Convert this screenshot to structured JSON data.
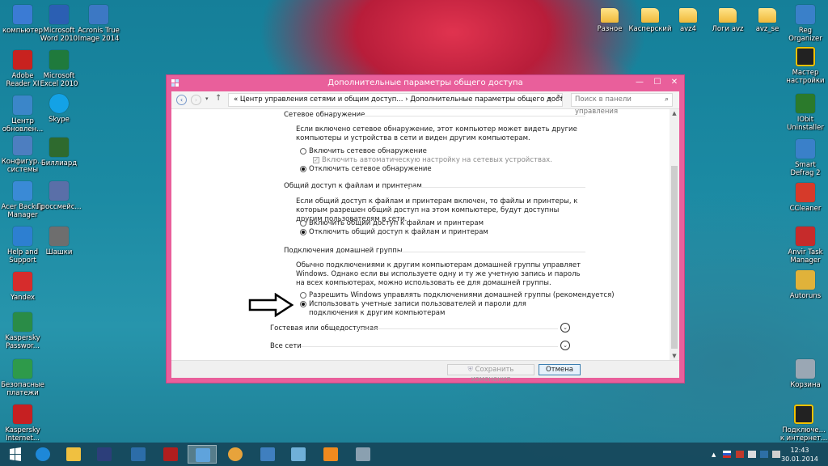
{
  "desktop": {
    "left_icons": [
      {
        "label": "компьютер",
        "color": "#3b7bd4"
      },
      {
        "label": "Adobe Reader XI",
        "color": "#c8221f"
      },
      {
        "label": "Центр обновлен...",
        "color": "#3b86c9"
      },
      {
        "label": "Конфигур... системы",
        "color": "#4d7ec0"
      },
      {
        "label": "Acer Backup Manager",
        "color": "#3a8ad6"
      },
      {
        "label": "Help and Support",
        "color": "#2d7fd1"
      },
      {
        "label": "Yandex",
        "color": "#d62c2c"
      },
      {
        "label": "Kaspersky Passwor...",
        "color": "#2a8c47"
      },
      {
        "label": "Безопасные платежи",
        "color": "#2e9a4a"
      },
      {
        "label": "Kaspersky Internet...",
        "color": "#c62022"
      }
    ],
    "col2_icons": [
      {
        "label": "Microsoft Word 2010",
        "color": "#2b5fb3"
      },
      {
        "label": "Microsoft Excel 2010",
        "color": "#1f7a3c"
      },
      {
        "label": "Skype",
        "color": "#13a2e6"
      },
      {
        "label": "Биллиард",
        "color": "#2e6a2e"
      },
      {
        "label": "Гроссмейс...",
        "color": "#5a6fa8"
      },
      {
        "label": "Шашки",
        "color": "#6e6e6e"
      }
    ],
    "col3_icons": [
      {
        "label": "Acronis True Image 2014",
        "color": "#3c78c4"
      }
    ],
    "top_folders": [
      "Разное",
      "Касперский",
      "avz4",
      "Логи avz",
      "avz_se"
    ],
    "right_icons": [
      {
        "label": "Reg Organizer",
        "color": "#3a80c9"
      },
      {
        "label": "Мастер настройки",
        "color": "#222222"
      },
      {
        "label": "IObit Uninstaller",
        "color": "#2b7a2b"
      },
      {
        "label": "Smart Defrag 2",
        "color": "#3a80c9"
      },
      {
        "label": "CCleaner",
        "color": "#d63a2a"
      },
      {
        "label": "Anvir Task Manager",
        "color": "#c62b2b"
      },
      {
        "label": "Autoruns",
        "color": "#e0b23a"
      },
      {
        "label": "Корзина",
        "color": "#9aa7b4"
      },
      {
        "label": "Подключе... к интернет...",
        "color": "#222222"
      }
    ]
  },
  "window": {
    "title": "Дополнительные параметры общего доступа",
    "min": "—",
    "max": "☐",
    "close": "✕",
    "address": "« Центр управления сетями и общим доступ... › Дополнительные параметры общего доступа",
    "search_placeholder": "Поиск в панели управления",
    "sections": {
      "discovery": {
        "header": "Сетевое обнаружение",
        "desc": "Если включено сетевое обнаружение, этот компьютер может видеть другие компьютеры и устройства в сети и виден другим компьютерам.",
        "opt_on": "Включить сетевое обнаружение",
        "opt_auto": "Включить автоматическую настройку на сетевых устройствах.",
        "opt_off": "Отключить сетевое обнаружение"
      },
      "sharing": {
        "header": "Общий доступ к файлам и принтерам",
        "desc": "Если общий доступ к файлам и принтерам включен, то файлы и принтеры, к которым разрешен общий доступ на этом компьютере, будут доступны другим пользователям в сети.",
        "opt_on": "Включить общий доступ к файлам и принтерам",
        "opt_off": "Отключить общий доступ к файлам и принтерам"
      },
      "homegroup": {
        "header": "Подключения домашней группы",
        "desc": "Обычно подключениями к другим компьютерам домашней группы управляет Windows. Однако если вы используете одну и ту же учетную запись и пароль на всех компьютерах, можно использовать ее для домашней группы.",
        "opt_windows": "Разрешить Windows управлять подключениями домашней группы (рекомендуется)",
        "opt_accounts": "Использовать учетные записи пользователей и пароли для подключения к другим компьютерам"
      }
    },
    "profile_guest": "Гостевая или общедоступная",
    "profile_all": "Все сети",
    "save_label": "Сохранить изменения",
    "cancel_label": "Отмена"
  },
  "taskbar": {
    "clock_time": "12:43",
    "clock_date": "30.01.2014"
  }
}
